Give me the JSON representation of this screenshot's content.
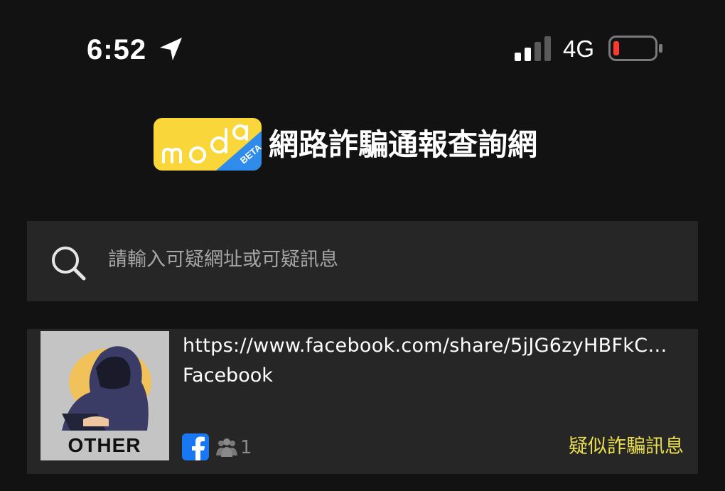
{
  "status_bar": {
    "time": "6:52",
    "network": "4G",
    "icons": [
      "location-arrow-icon",
      "signal-bars-icon",
      "battery-low-icon"
    ]
  },
  "header": {
    "logo_text": "moda",
    "logo_badge": "BETA",
    "title": "網路詐騙通報查詢網"
  },
  "search": {
    "placeholder": "請輸入可疑網址或可疑訊息",
    "icon": "search-icon"
  },
  "results": [
    {
      "url": "https://www.facebook.com/share/5jJG6zyHBFkC…",
      "source": "Facebook",
      "thumbnail_label": "OTHER",
      "platform_icon": "facebook-icon",
      "report_count": "1",
      "status": "疑似詐騙訊息"
    }
  ],
  "colors": {
    "background": "#121212",
    "panel": "#262626",
    "logo_yellow": "#f9d63a",
    "logo_badge_blue": "#2f8cea",
    "status_yellow": "#e9dc4e",
    "facebook_blue": "#1877f2",
    "battery_red": "#ff3b30"
  }
}
